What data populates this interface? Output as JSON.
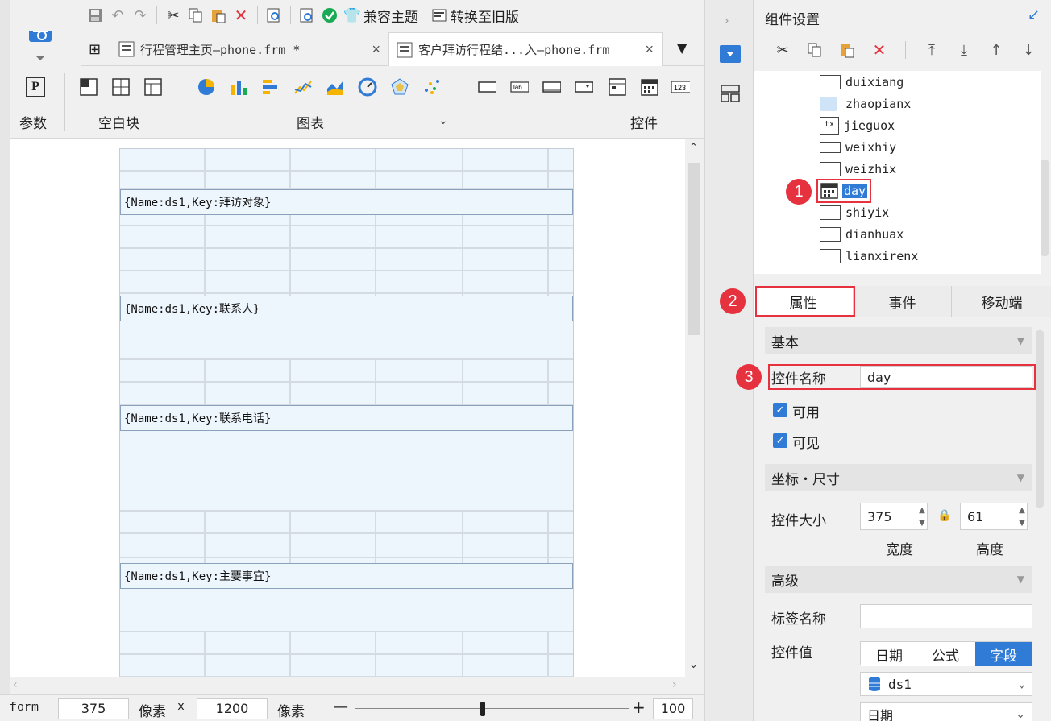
{
  "toolbar": {
    "compat_theme": "兼容主题",
    "convert_old": "转换至旧版"
  },
  "tabs": [
    {
      "label": "行程管理主页—phone.frm *",
      "close": "×"
    },
    {
      "label": "客户拜访行程结...入—phone.frm",
      "close": "×"
    }
  ],
  "ribbon": {
    "params": "参数",
    "blank": "空白块",
    "chart": "图表",
    "controls": "控件"
  },
  "form_fields": [
    "{Name:ds1,Key:拜访对象}",
    "{Name:ds1,Key:联系人}",
    "{Name:ds1,Key:联系电话}",
    "{Name:ds1,Key:主要事宜}"
  ],
  "statusbar": {
    "mode": "form",
    "width": "375",
    "unit1": "像素",
    "times": "x",
    "height": "1200",
    "unit2": "像素",
    "minus": "—",
    "plus": "+",
    "zoom": "100"
  },
  "panel": {
    "title": "组件设置",
    "tree": [
      {
        "name": "duixiang",
        "icon": "textbox-icon"
      },
      {
        "name": "zhaopianx",
        "icon": "image-icon"
      },
      {
        "name": "jieguox",
        "icon": "text-icon"
      },
      {
        "name": "weixhiy",
        "icon": "label-icon"
      },
      {
        "name": "weizhix",
        "icon": "textbox-icon"
      },
      {
        "name": "day",
        "icon": "calendar-icon",
        "selected": true
      },
      {
        "name": "shiyix",
        "icon": "textbox-icon"
      },
      {
        "name": "dianhuax",
        "icon": "textbox-icon"
      },
      {
        "name": "lianxirenx",
        "icon": "textbox-icon"
      }
    ],
    "tabs": [
      "属性",
      "事件",
      "移动端"
    ],
    "badges": [
      "1",
      "2",
      "3"
    ],
    "basic": "基本",
    "name_label": "控件名称",
    "name_value": "day",
    "enabled": "可用",
    "visible": "可见",
    "geo": "坐标・尺寸",
    "size_label": "控件大小",
    "width_value": "375",
    "height_value": "61",
    "width_label": "宽度",
    "height_label": "高度",
    "advanced": "高级",
    "tag_label": "标签名称",
    "tag_value": "",
    "value_label": "控件值",
    "value_modes": [
      "日期",
      "公式",
      "字段"
    ],
    "dataset": "ds1",
    "field_partial": "日期"
  }
}
